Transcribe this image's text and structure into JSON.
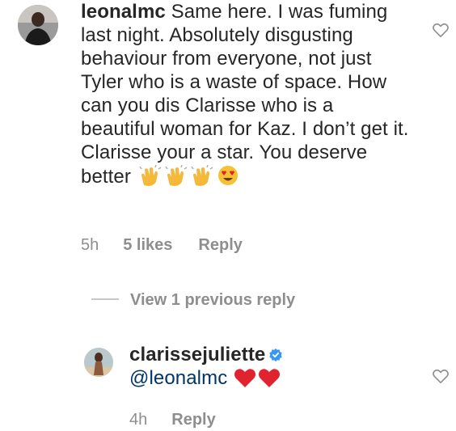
{
  "comment": {
    "username": "leonalmc",
    "body": " Same here. I was fuming last night. Absolutely disgusting behaviour from everyone, not just Tyler who is a waste of space. How can you dis Clarisse who is a beautiful woman for Kaz. I don’t get it. Clarisse your a star. You deserve better",
    "emojis": [
      "clapping-hands",
      "clapping-hands",
      "clapping-hands",
      "heart-eyes-face"
    ],
    "time": "5h",
    "likes": "5 likes",
    "reply_label": "Reply"
  },
  "view_previous": "View 1 previous reply",
  "reply": {
    "username": "clarissejuliette",
    "verified": true,
    "mention": "@leonalmc",
    "emojis": [
      "red-heart",
      "red-heart"
    ],
    "time": "4h",
    "reply_label": "Reply"
  },
  "colors": {
    "text": "#262626",
    "meta": "#8e8e8e",
    "verified": "#3897f0",
    "heart_emoji": "#e0242f"
  }
}
